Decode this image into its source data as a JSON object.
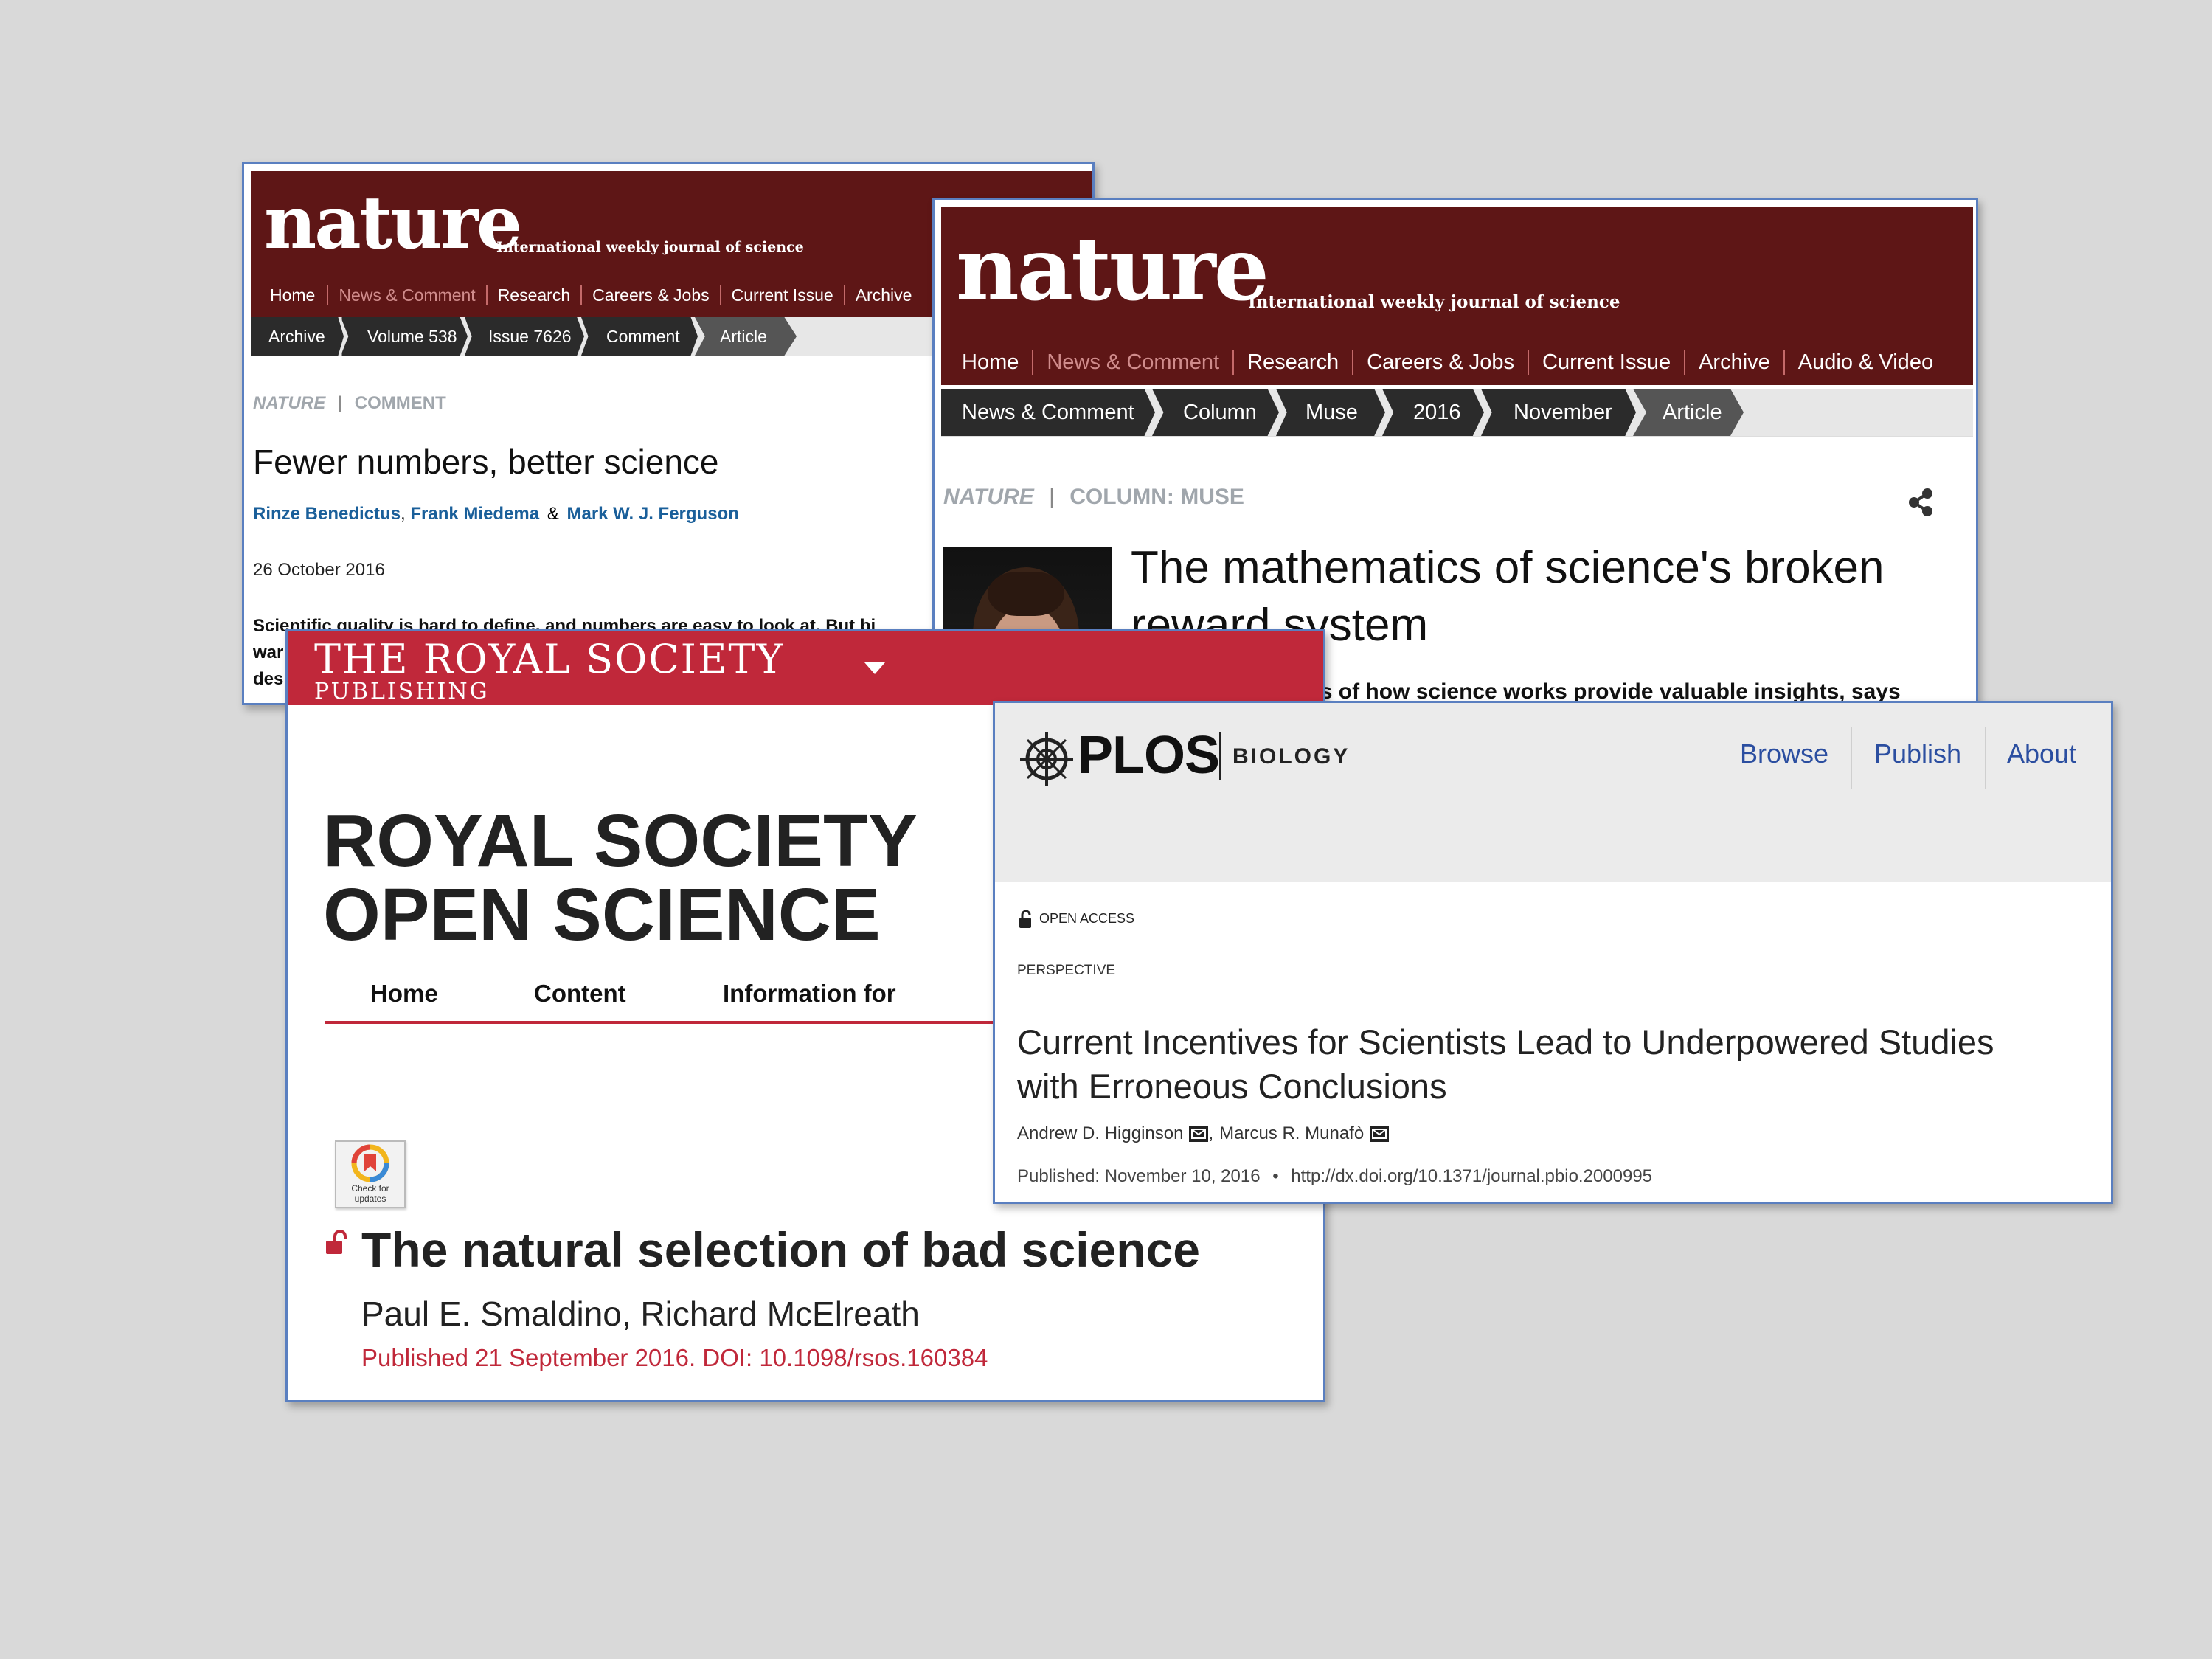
{
  "nature1": {
    "logo": "nature",
    "tagline": "International weekly journal of science",
    "nav": [
      "Home",
      "News & Comment",
      "Research",
      "Careers & Jobs",
      "Current Issue",
      "Archive"
    ],
    "breadcrumbs": [
      "Archive",
      "Volume 538",
      "Issue 7626",
      "Comment",
      "Article"
    ],
    "section_journal": "NATURE",
    "section_sep": "|",
    "section_name": "COMMENT",
    "title": "Fewer numbers, better science",
    "author1": "Rinze Benedictus",
    "comma": ",",
    "author2": "Frank Miedema",
    "amp": "&",
    "author3": "Mark W. J. Ferguson",
    "date": "26 October 2016",
    "summary_line1": "Scientific quality is hard to define, and numbers are easy to look at. But bi",
    "summary_line2": "war",
    "summary_line3": "des"
  },
  "nature2": {
    "logo": "nature",
    "tagline": "International weekly journal of science",
    "nav": [
      "Home",
      "News & Comment",
      "Research",
      "Careers & Jobs",
      "Current Issue",
      "Archive",
      "Audio & Video"
    ],
    "breadcrumbs": [
      "News & Comment",
      "Column",
      "Muse",
      "2016",
      "November",
      "Article"
    ],
    "section_journal": "NATURE",
    "section_sep": "|",
    "section_name": "COLUMN: MUSE",
    "title_line1": "The mathematics of science's broken",
    "title_line2": "reward system",
    "standfirst": "Theoretical models of how science works provide valuable insights, says"
  },
  "royal": {
    "brand_line1": "THE ROYAL SOCIETY",
    "brand_line2": "PUBLISHING",
    "journal_line1": "ROYAL SOCIETY",
    "journal_line2": "OPEN SCIENCE",
    "nav": [
      "Home",
      "Content",
      "Information for"
    ],
    "badge_line1": "Check for",
    "badge_line2": "updates",
    "title": "The natural selection of bad science",
    "authors": "Paul E. Smaldino, Richard McElreath",
    "published": "Published 21 September 2016. DOI: 10.1098/rsos.160384"
  },
  "plos": {
    "logo": "PLOS",
    "journal": "BIOLOGY",
    "nav": [
      "Browse",
      "Publish",
      "About"
    ],
    "access": "OPEN ACCESS",
    "type": "PERSPECTIVE",
    "title_line1": "Current Incentives for Scientists Lead to Underpowered Studies",
    "title_line2": "with Erroneous Conclusions",
    "author1": "Andrew D. Higginson",
    "comma": ",",
    "author2": "Marcus R. Munafò",
    "published": "Published: November 10, 2016",
    "bullet": "•",
    "doi": "http://dx.doi.org/10.1371/journal.pbio.2000995"
  },
  "colors": {
    "nature_red": "#5e1616",
    "crumb_dark": "#2b2b2b",
    "crumb_last": "#555555",
    "royal_red": "#c0283a",
    "plos_blue": "#2b4ea0",
    "link_blue": "#1a5f9a",
    "window_border": "#5a7fc0"
  },
  "icons": [
    "share-icon",
    "chevron-down-icon",
    "open-lock-icon",
    "lock-icon",
    "email-icon",
    "plos-logo-icon",
    "author-photo"
  ]
}
